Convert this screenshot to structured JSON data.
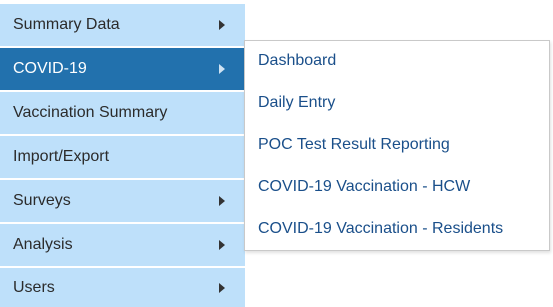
{
  "sidebar": {
    "items": [
      {
        "label": "Summary Data",
        "has_submenu": true
      },
      {
        "label": "COVID-19",
        "has_submenu": true,
        "active": true
      },
      {
        "label": "Vaccination Summary",
        "has_submenu": false
      },
      {
        "label": "Import/Export",
        "has_submenu": false
      },
      {
        "label": "Surveys",
        "has_submenu": true
      },
      {
        "label": "Analysis",
        "has_submenu": true
      },
      {
        "label": "Users",
        "has_submenu": true
      }
    ]
  },
  "submenu": {
    "items": [
      {
        "label": "Dashboard"
      },
      {
        "label": "Daily Entry"
      },
      {
        "label": "POC Test Result Reporting"
      },
      {
        "label": "COVID-19 Vaccination - HCW"
      },
      {
        "label": "COVID-19 Vaccination - Residents"
      }
    ]
  },
  "colors": {
    "menu_bg": "#bee0fa",
    "active_bg": "#2271ad",
    "active_text": "#ffffff",
    "menu_text": "#2b2b2b",
    "submenu_text": "#1a4f8a",
    "submenu_border": "#c9c9c9"
  },
  "icons": {
    "submenu_indicator": "caret-right-icon"
  }
}
